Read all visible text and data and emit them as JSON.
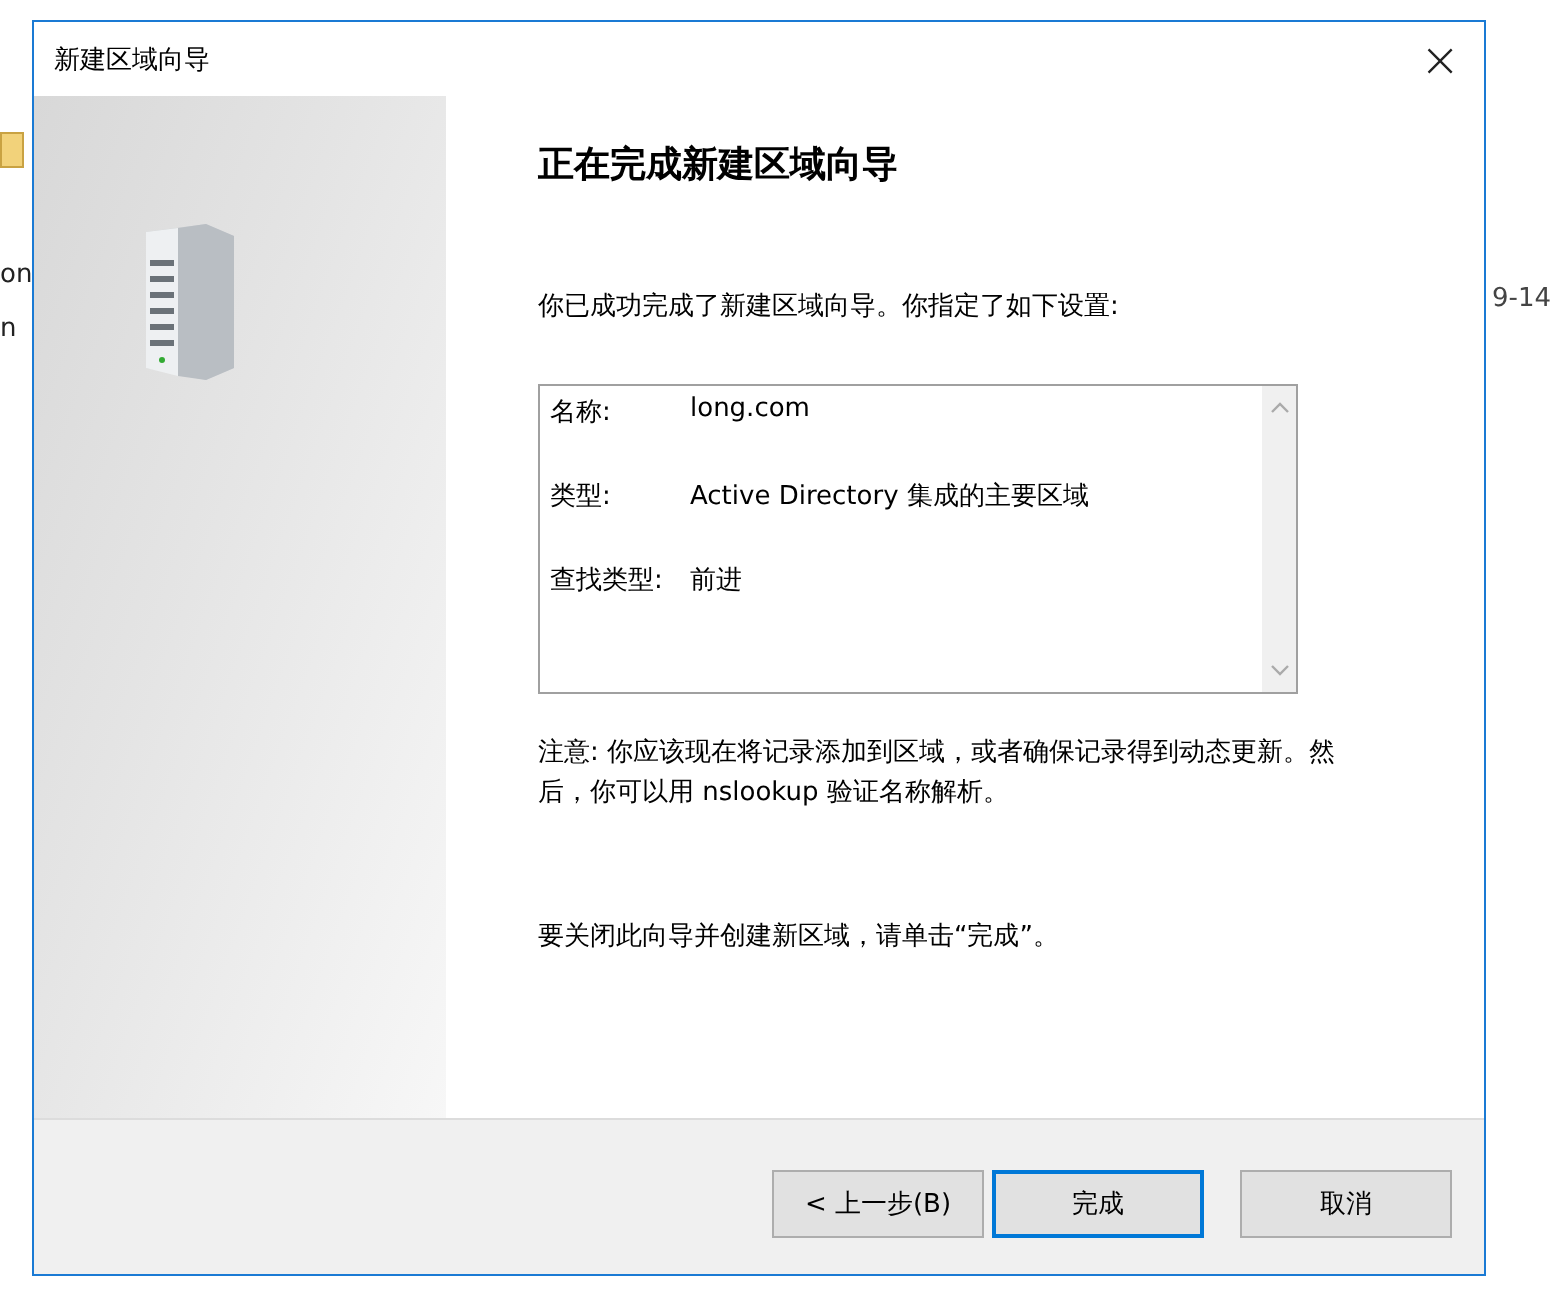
{
  "background_window": {
    "left_texts": [
      "on",
      "n"
    ],
    "right_text": "9-14"
  },
  "window": {
    "title": "新建区域向导",
    "close": "×"
  },
  "heading": "正在完成新建区域向导",
  "intro": "你已成功完成了新建区域向导。你指定了如下设置:",
  "settings": [
    {
      "label": "名称:",
      "value": "long.com"
    },
    {
      "label": "类型:",
      "value": "Active Directory 集成的主要区域"
    },
    {
      "label": "查找类型:",
      "value": "前进"
    }
  ],
  "note": "注意: 你应该现在将记录添加到区域，或者确保记录得到动态更新。然后，你可以用 nslookup 验证名称解析。",
  "closing": "要关闭此向导并创建新区域，请单击“完成”。",
  "buttons": [
    {
      "label": "< 上一步(B)",
      "selected": false
    },
    {
      "label": "完成",
      "selected": true
    },
    {
      "label": "取消",
      "selected": false
    }
  ]
}
